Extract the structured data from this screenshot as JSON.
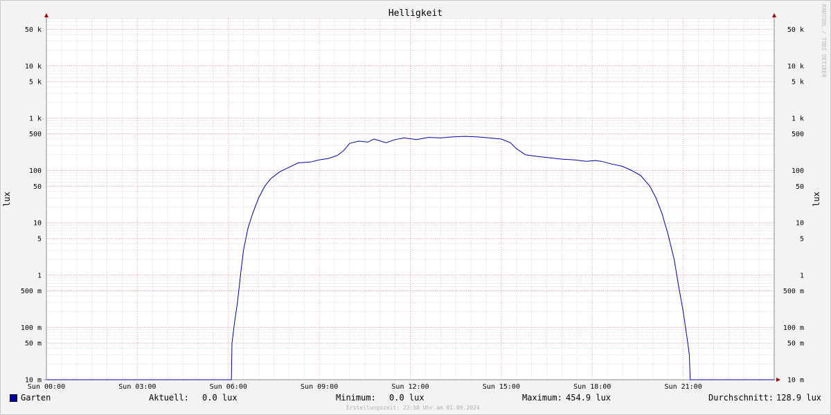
{
  "chart_data": {
    "type": "line",
    "title": "Helligkeit",
    "ylabel_left": "lux",
    "ylabel_right": "lux",
    "y_scale": "log",
    "ylim": [
      0.01,
      80000
    ],
    "xlim_hours": [
      0,
      24
    ],
    "x_ticks": [
      {
        "h": 0,
        "label": "Sun 00:00"
      },
      {
        "h": 3,
        "label": "Sun 03:00"
      },
      {
        "h": 6,
        "label": "Sun 06:00"
      },
      {
        "h": 9,
        "label": "Sun 09:00"
      },
      {
        "h": 12,
        "label": "Sun 12:00"
      },
      {
        "h": 15,
        "label": "Sun 15:00"
      },
      {
        "h": 18,
        "label": "Sun 18:00"
      },
      {
        "h": 21,
        "label": "Sun 21:00"
      }
    ],
    "y_ticks": [
      {
        "v": 50000,
        "label": "50 k"
      },
      {
        "v": 10000,
        "label": "10 k"
      },
      {
        "v": 5000,
        "label": "5 k"
      },
      {
        "v": 1000,
        "label": "1 k"
      },
      {
        "v": 500,
        "label": "500"
      },
      {
        "v": 100,
        "label": "100"
      },
      {
        "v": 50,
        "label": "50"
      },
      {
        "v": 10,
        "label": "10"
      },
      {
        "v": 5,
        "label": "5"
      },
      {
        "v": 1,
        "label": "1"
      },
      {
        "v": 0.5,
        "label": "500 m"
      },
      {
        "v": 0.1,
        "label": "100 m"
      },
      {
        "v": 0.05,
        "label": "50 m"
      },
      {
        "v": 0.01,
        "label": "10 m"
      }
    ],
    "grid": true,
    "series": [
      {
        "name": "Garten",
        "color": "#0000a0",
        "points": [
          [
            0,
            0.01
          ],
          [
            6.1,
            0.01
          ],
          [
            6.12,
            0.05
          ],
          [
            6.2,
            0.12
          ],
          [
            6.3,
            0.3
          ],
          [
            6.4,
            1.0
          ],
          [
            6.5,
            3.0
          ],
          [
            6.65,
            8.0
          ],
          [
            6.8,
            15
          ],
          [
            7.0,
            30
          ],
          [
            7.2,
            50
          ],
          [
            7.4,
            70
          ],
          [
            7.7,
            95
          ],
          [
            8.0,
            115
          ],
          [
            8.3,
            140
          ],
          [
            8.7,
            145
          ],
          [
            9.0,
            160
          ],
          [
            9.3,
            170
          ],
          [
            9.6,
            195
          ],
          [
            9.8,
            240
          ],
          [
            10.0,
            330
          ],
          [
            10.3,
            365
          ],
          [
            10.6,
            350
          ],
          [
            10.8,
            400
          ],
          [
            11.2,
            340
          ],
          [
            11.5,
            390
          ],
          [
            11.8,
            420
          ],
          [
            12.2,
            390
          ],
          [
            12.6,
            430
          ],
          [
            13.0,
            420
          ],
          [
            13.4,
            440
          ],
          [
            13.8,
            450
          ],
          [
            14.2,
            440
          ],
          [
            14.6,
            420
          ],
          [
            15.0,
            400
          ],
          [
            15.3,
            340
          ],
          [
            15.5,
            260
          ],
          [
            15.8,
            200
          ],
          [
            16.2,
            185
          ],
          [
            16.6,
            175
          ],
          [
            17.0,
            165
          ],
          [
            17.4,
            160
          ],
          [
            17.8,
            150
          ],
          [
            18.1,
            155
          ],
          [
            18.3,
            150
          ],
          [
            18.6,
            135
          ],
          [
            19.0,
            120
          ],
          [
            19.3,
            100
          ],
          [
            19.6,
            80
          ],
          [
            19.9,
            50
          ],
          [
            20.1,
            30
          ],
          [
            20.3,
            15
          ],
          [
            20.5,
            6.0
          ],
          [
            20.7,
            2.0
          ],
          [
            20.85,
            0.6
          ],
          [
            21.0,
            0.2
          ],
          [
            21.15,
            0.05
          ],
          [
            21.2,
            0.03
          ],
          [
            21.23,
            0.01
          ],
          [
            24,
            0.01
          ]
        ]
      }
    ]
  },
  "legend": {
    "series_name": "Garten",
    "current_label": "Aktuell:",
    "current_value": "0.0 lux",
    "min_label": "Minimum:",
    "min_value": "0.0 lux",
    "max_label": "Maximum:",
    "max_value": "454.9 lux",
    "avg_label": "Durchschnitt:",
    "avg_value": "128.9 lux"
  },
  "footer": {
    "created": "Erstellungszeit: 23:58 Uhr am 01.09.2024"
  },
  "watermark": "RRDTOOL / TOBI OETIKER"
}
